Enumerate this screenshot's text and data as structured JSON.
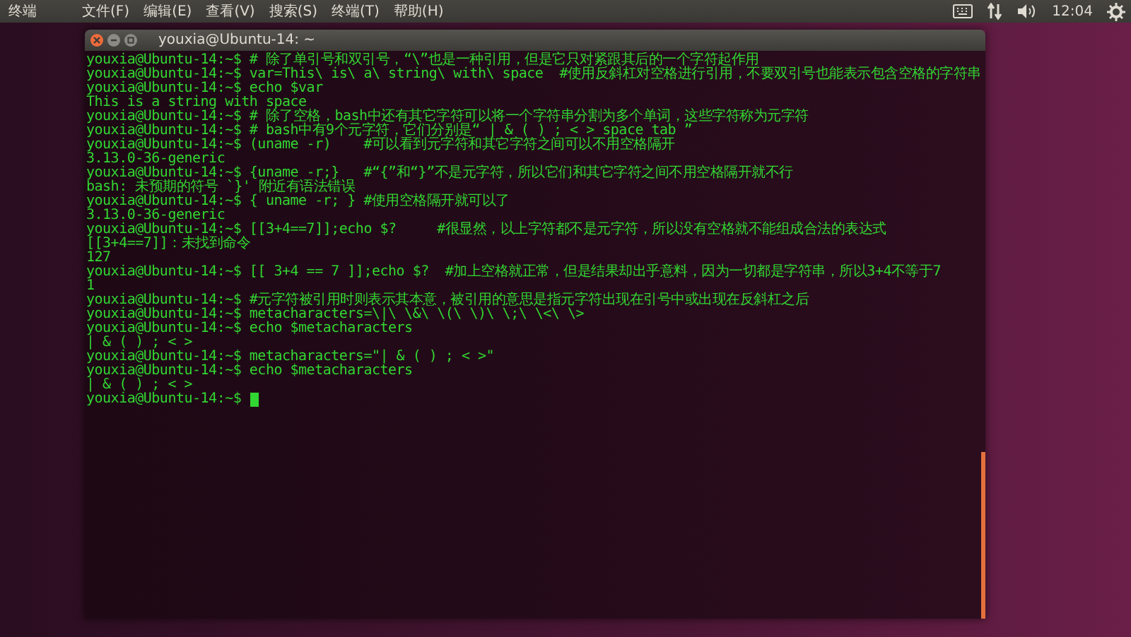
{
  "top_panel": {
    "app_name": "终端",
    "menus": [
      "文件(F)",
      "编辑(E)",
      "查看(V)",
      "搜索(S)",
      "终端(T)",
      "帮助(H)"
    ],
    "clock": "12:04"
  },
  "window": {
    "title": "youxia@Ubuntu-14: ~"
  },
  "terminal": {
    "lines": [
      "youxia@Ubuntu-14:~$ # 除了单引号和双引号，“\\”也是一种引用，但是它只对紧跟其后的一个字符起作用",
      "youxia@Ubuntu-14:~$ var=This\\ is\\ a\\ string\\ with\\ space  #使用反斜杠对空格进行引用，不要双引号也能表示包含空格的字符串",
      "youxia@Ubuntu-14:~$ echo $var",
      "This is a string with space",
      "youxia@Ubuntu-14:~$ # 除了空格，bash中还有其它字符可以将一个字符串分割为多个单词，这些字符称为元字符",
      "youxia@Ubuntu-14:~$ # bash中有9个元字符，它们分别是“ | & ( ) ; < > space tab ”",
      "youxia@Ubuntu-14:~$ (uname -r)    #可以看到元字符和其它字符之间可以不用空格隔开",
      "3.13.0-36-generic",
      "youxia@Ubuntu-14:~$ {uname -r;}   #“{”和“}”不是元字符，所以它们和其它字符之间不用空格隔开就不行",
      "bash: 未预期的符号 `}' 附近有语法错误",
      "youxia@Ubuntu-14:~$ { uname -r; } #使用空格隔开就可以了",
      "3.13.0-36-generic",
      "youxia@Ubuntu-14:~$ [[3+4==7]];echo $?     #很显然，以上字符都不是元字符，所以没有空格就不能组成合法的表达式",
      "[[3+4==7]]：未找到命令",
      "127",
      "youxia@Ubuntu-14:~$ [[ 3+4 == 7 ]];echo $?  #加上空格就正常，但是结果却出乎意料，因为一切都是字符串，所以3+4不等于7",
      "1",
      "youxia@Ubuntu-14:~$ #元字符被引用时则表示其本意，被引用的意思是指元字符出现在引号中或出现在反斜杠之后",
      "youxia@Ubuntu-14:~$ metacharacters=\\|\\ \\&\\ \\(\\ \\)\\ \\;\\ \\<\\ \\>",
      "youxia@Ubuntu-14:~$ echo $metacharacters",
      "| & ( ) ; < >",
      "youxia@Ubuntu-14:~$ metacharacters=\"| & ( ) ; < >\"",
      "youxia@Ubuntu-14:~$ echo $metacharacters",
      "| & ( ) ; < >"
    ],
    "current_prompt": "youxia@Ubuntu-14:~$"
  }
}
